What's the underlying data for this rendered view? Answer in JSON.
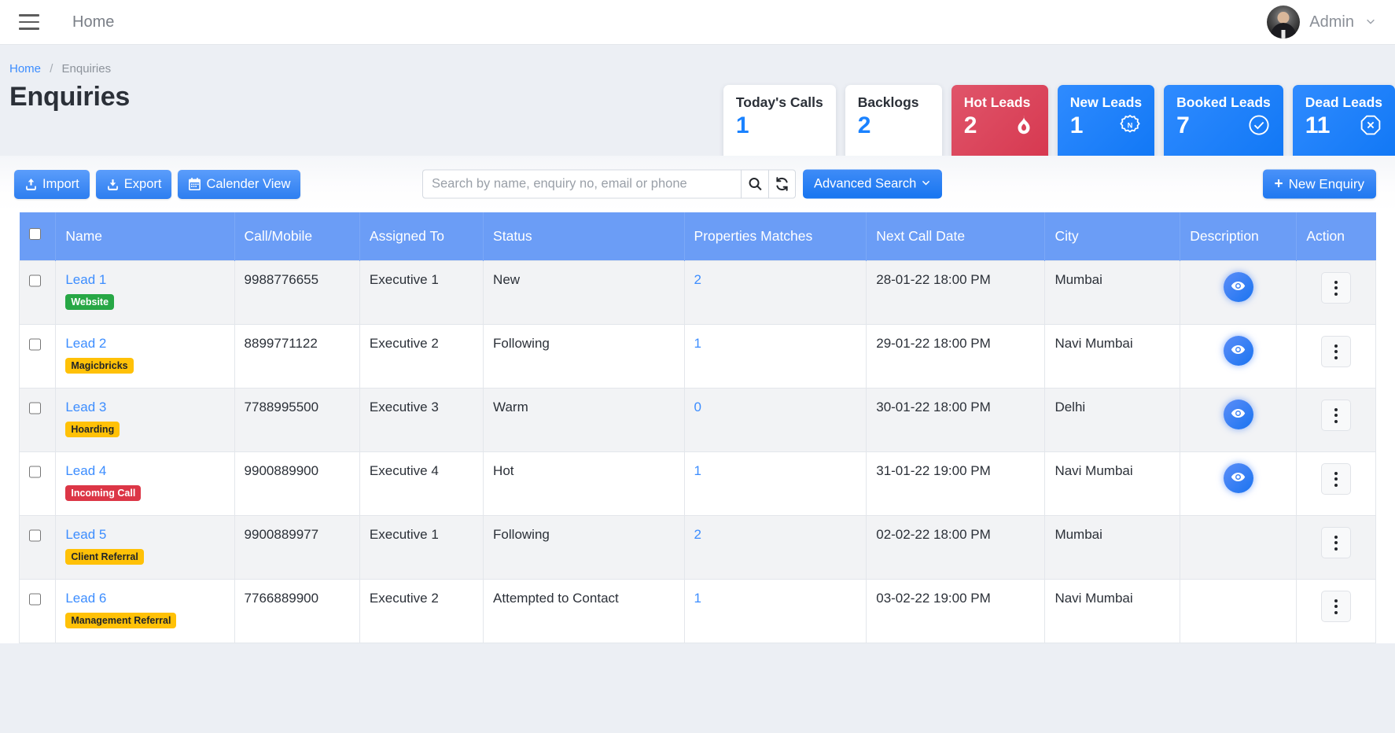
{
  "navbar": {
    "menu_icon": "hamburger-icon",
    "home_label": "Home",
    "user_name": "Admin",
    "user_chevron": "⌄"
  },
  "breadcrumb": {
    "home": "Home",
    "separator": "/",
    "current": "Enquiries"
  },
  "page": {
    "title": "Enquiries"
  },
  "stat_cards": [
    {
      "title": "Today's Calls",
      "value": "1",
      "style": "white",
      "icon": ""
    },
    {
      "title": "Backlogs",
      "value": "2",
      "style": "white",
      "icon": ""
    },
    {
      "title": "Hot Leads",
      "value": "2",
      "style": "red",
      "icon": "fire-icon",
      "color": "#d6374f"
    },
    {
      "title": "New Leads",
      "value": "1",
      "style": "blue",
      "icon": "new-badge-icon",
      "color": "#1077f5"
    },
    {
      "title": "Booked Leads",
      "value": "7",
      "style": "blue",
      "icon": "check-circle-icon",
      "color": "#1077f5"
    },
    {
      "title": "Dead Leads",
      "value": "11",
      "style": "blue",
      "icon": "octagon-x-icon",
      "color": "#1077f5"
    }
  ],
  "toolbar": {
    "import_label": "Import",
    "export_label": "Export",
    "calendar_label": "Calender View",
    "advanced_search_label": "Advanced Search",
    "new_enquiry_label": "New Enquiry"
  },
  "search": {
    "placeholder": "Search by name, enquiry no, email or phone",
    "value": "",
    "search_icon": "search-icon",
    "refresh_icon": "refresh-icon"
  },
  "table": {
    "columns": [
      "",
      "Name",
      "Call/Mobile",
      "Assigned To",
      "Status",
      "Properties Matches",
      "Next Call Date",
      "City",
      "Description",
      "Action"
    ],
    "rows": [
      {
        "name": "Lead 1",
        "tag": "Website",
        "tag_color": "green",
        "mobile": "9988776655",
        "assigned_to": "Executive 1",
        "status": "New",
        "properties_matches": "2",
        "next_call_date": "28-01-22 18:00 PM",
        "city": "Mumbai",
        "has_description": true
      },
      {
        "name": "Lead 2",
        "tag": "Magicbricks",
        "tag_color": "yellow",
        "mobile": "8899771122",
        "assigned_to": "Executive 2",
        "status": "Following",
        "properties_matches": "1",
        "next_call_date": "29-01-22 18:00 PM",
        "city": "Navi Mumbai",
        "has_description": true
      },
      {
        "name": "Lead 3",
        "tag": "Hoarding",
        "tag_color": "yellow",
        "mobile": "7788995500",
        "assigned_to": "Executive 3",
        "status": "Warm",
        "properties_matches": "0",
        "next_call_date": "30-01-22 18:00 PM",
        "city": "Delhi",
        "has_description": true
      },
      {
        "name": "Lead 4",
        "tag": "Incoming Call",
        "tag_color": "red",
        "mobile": "9900889900",
        "assigned_to": "Executive 4",
        "status": "Hot",
        "properties_matches": "1",
        "next_call_date": "31-01-22 19:00 PM",
        "city": "Navi Mumbai",
        "has_description": true
      },
      {
        "name": "Lead 5",
        "tag": "Client Referral",
        "tag_color": "yellow",
        "mobile": "9900889977",
        "assigned_to": "Executive 1",
        "status": "Following",
        "properties_matches": "2",
        "next_call_date": "02-02-22 18:00 PM",
        "city": "Mumbai",
        "has_description": false
      },
      {
        "name": "Lead 6",
        "tag": "Management Referral",
        "tag_color": "yellow",
        "mobile": "7766889900",
        "assigned_to": "Executive 2",
        "status": "Attempted to Contact",
        "properties_matches": "1",
        "next_call_date": "03-02-22 19:00 PM",
        "city": "Navi Mumbai",
        "has_description": false
      }
    ]
  },
  "colors": {
    "accent_blue": "#1a82ff",
    "table_header_blue": "#6b9df6",
    "hot_red": "#d6374f",
    "tag_green": "#27a745",
    "tag_yellow": "#ffc107",
    "tag_red": "#dc3646",
    "page_bg": "#eceff4"
  }
}
